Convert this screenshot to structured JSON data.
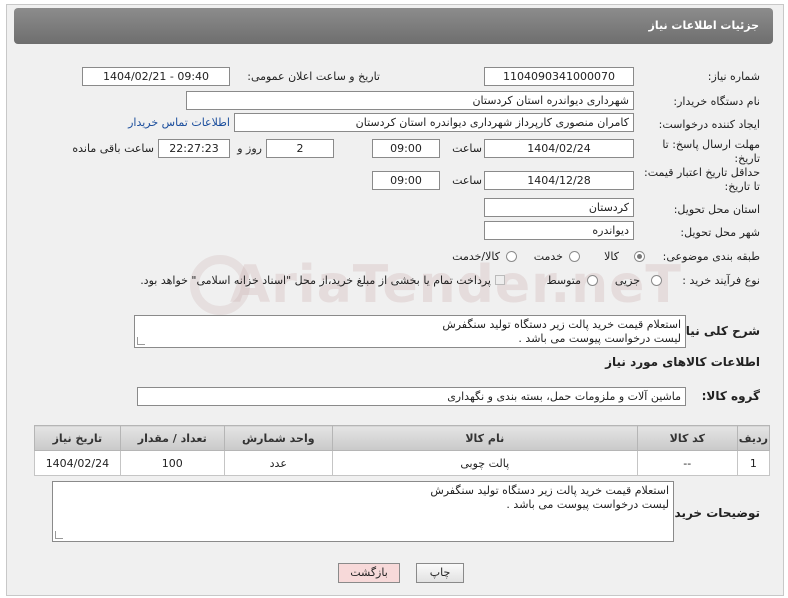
{
  "header": {
    "title": "جزئیات اطلاعات نیاز"
  },
  "fields": {
    "need_number_label": "شماره نیاز:",
    "need_number": "1104090341000070",
    "announce_label": "تاریخ و ساعت اعلان عمومی:",
    "announce_value": "1404/02/21 - 09:40",
    "buyer_org_label": "نام دستگاه خریدار:",
    "buyer_org": "شهرداری دیواندره استان کردستان",
    "creator_label": "ایجاد کننده درخواست:",
    "creator": "کامران منصوری کارپرداز شهرداری دیواندره استان کردستان",
    "buyer_contact_link": "اطلاعات تماس خریدار",
    "deadline_label": "مهلت ارسال پاسخ: تا تاریخ:",
    "deadline_date": "1404/02/24",
    "time_label": "ساعت",
    "deadline_time": "09:00",
    "days_value": "2",
    "days_label": "روز و",
    "remaining_time": "22:27:23",
    "remaining_label": "ساعت باقی مانده",
    "price_valid_label": "حداقل تاریخ اعتبار قیمت: تا تاریخ:",
    "price_valid_date": "1404/12/28",
    "price_valid_time": "09:00",
    "province_label": "استان محل تحویل:",
    "province": "کردستان",
    "city_label": "شهر محل تحویل:",
    "city": "دیواندره",
    "category_label": "طبقه بندی موضوعی:",
    "category_options": [
      "کالا",
      "خدمت",
      "کالا/خدمت"
    ],
    "process_label": "نوع فرآیند خرید :",
    "process_options": [
      "جزیی",
      "متوسط"
    ],
    "payment_note": "پرداخت تمام یا بخشی از مبلغ خرید،از محل \"اسناد خزانه اسلامی\" خواهد بود.",
    "description_label": "شرح کلی نیاز:",
    "description_line1": "استعلام قیمت خرید پالت زیر دستگاه تولید سنگفرش",
    "description_line2": "لیست درخواست پیوست می باشد .",
    "goods_info_title": "اطلاعات کالاهای مورد نیاز",
    "goods_group_label": "گروه کالا:",
    "goods_group": "ماشین آلات و ملزومات حمل، بسته بندی و نگهداری"
  },
  "table": {
    "headers": [
      "ردیف",
      "کد کالا",
      "نام کالا",
      "واحد شمارش",
      "تعداد / مقدار",
      "تاریخ نیاز"
    ],
    "rows": [
      [
        "1",
        "--",
        "پالت چوبی",
        "عدد",
        "100",
        "1404/02/24"
      ]
    ]
  },
  "buyer_notes": {
    "label": "توضیحات خریدار:",
    "line1": "استعلام قیمت خرید پالت زیر دستگاه تولید سنگفرش",
    "line2": "لیست درخواست پیوست می باشد ."
  },
  "buttons": {
    "print": "چاپ",
    "back": "بازگشت"
  },
  "watermark": "AriaTender.neT",
  "colors": {
    "header_bg": "#7a7a7a",
    "link": "#1a4d9c",
    "back_button_bg": "#f7d9d9",
    "panel_bg": "#f0f0f0"
  }
}
